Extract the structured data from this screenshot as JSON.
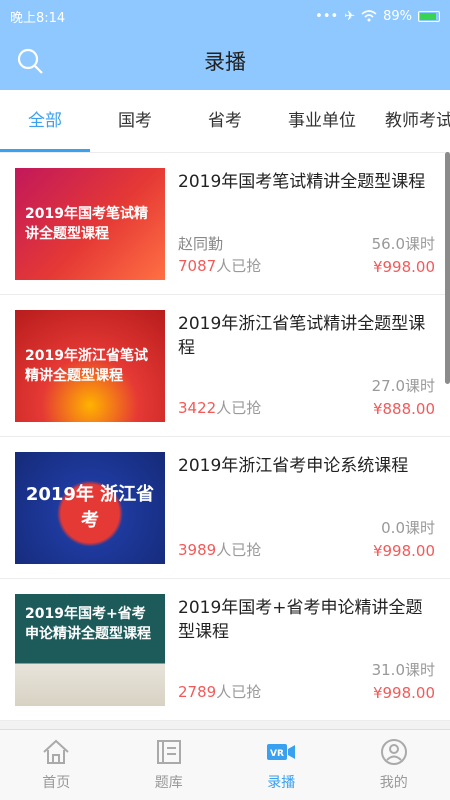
{
  "status": {
    "time": "晚上8:14",
    "battery": "89%"
  },
  "header": {
    "title": "录播"
  },
  "tabs": [
    {
      "label": "全部"
    },
    {
      "label": "国考"
    },
    {
      "label": "省考"
    },
    {
      "label": "事业单位"
    },
    {
      "label": "教师考试"
    }
  ],
  "courses": [
    {
      "thumb_text": "2019年国考笔试精讲全题型课程",
      "title": "2019年国考笔试精讲全题型课程",
      "teacher": "赵同勤",
      "hours": "56.0课时",
      "sold_count": "7087",
      "sold_suffix": "人已抢",
      "price": "¥998.00"
    },
    {
      "thumb_text": "2019年浙江省笔试精讲全题型课程",
      "title": "2019年浙江省笔试精讲全题型课程",
      "teacher": "",
      "hours": "27.0课时",
      "sold_count": "3422",
      "sold_suffix": "人已抢",
      "price": "¥888.00"
    },
    {
      "thumb_text": "2019年 浙江省考",
      "title": "2019年浙江省考申论系统课程",
      "teacher": "",
      "hours": "0.0课时",
      "sold_count": "3989",
      "sold_suffix": "人已抢",
      "price": "¥998.00"
    },
    {
      "thumb_text": "2019年国考+省考申论精讲全题型课程",
      "title": "2019年国考+省考申论精讲全题型课程",
      "teacher": "",
      "hours": "31.0课时",
      "sold_count": "2789",
      "sold_suffix": "人已抢",
      "price": "¥998.00"
    }
  ],
  "bottom_nav": [
    {
      "label": "首页",
      "icon": "home-icon"
    },
    {
      "label": "题库",
      "icon": "question-bank-icon"
    },
    {
      "label": "录播",
      "icon": "vr-video-icon"
    },
    {
      "label": "我的",
      "icon": "profile-icon"
    }
  ],
  "colors": {
    "accent": "#3aa0f0",
    "header_bg": "#8ec8ff",
    "price": "#f25a5a"
  }
}
